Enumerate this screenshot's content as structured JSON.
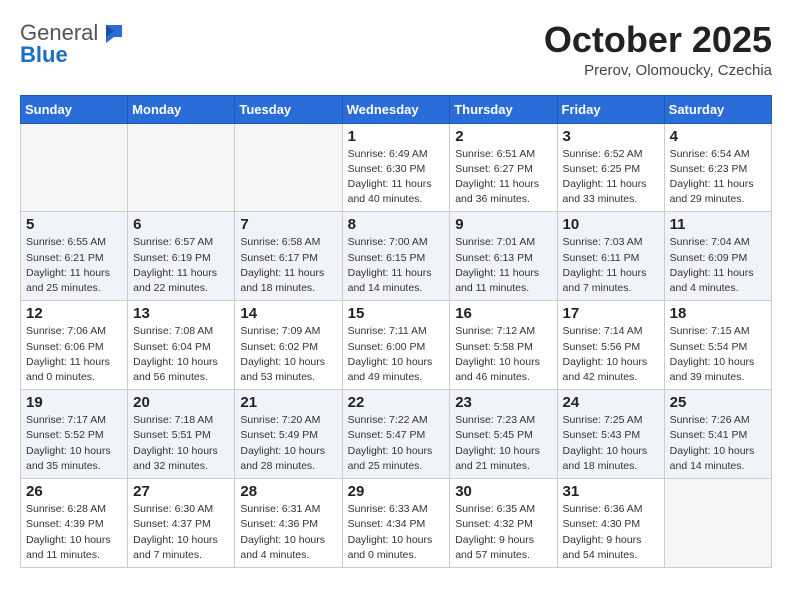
{
  "header": {
    "logo": {
      "general": "General",
      "blue": "Blue"
    },
    "title": "October 2025",
    "location": "Prerov, Olomoucky, Czechia"
  },
  "weekdays": [
    "Sunday",
    "Monday",
    "Tuesday",
    "Wednesday",
    "Thursday",
    "Friday",
    "Saturday"
  ],
  "weeks": [
    [
      {
        "day": "",
        "empty": true
      },
      {
        "day": "",
        "empty": true
      },
      {
        "day": "",
        "empty": true
      },
      {
        "day": "1",
        "sunrise": "6:49 AM",
        "sunset": "6:30 PM",
        "daylight": "11 hours and 40 minutes."
      },
      {
        "day": "2",
        "sunrise": "6:51 AM",
        "sunset": "6:27 PM",
        "daylight": "11 hours and 36 minutes."
      },
      {
        "day": "3",
        "sunrise": "6:52 AM",
        "sunset": "6:25 PM",
        "daylight": "11 hours and 33 minutes."
      },
      {
        "day": "4",
        "sunrise": "6:54 AM",
        "sunset": "6:23 PM",
        "daylight": "11 hours and 29 minutes."
      }
    ],
    [
      {
        "day": "5",
        "sunrise": "6:55 AM",
        "sunset": "6:21 PM",
        "daylight": "11 hours and 25 minutes."
      },
      {
        "day": "6",
        "sunrise": "6:57 AM",
        "sunset": "6:19 PM",
        "daylight": "11 hours and 22 minutes."
      },
      {
        "day": "7",
        "sunrise": "6:58 AM",
        "sunset": "6:17 PM",
        "daylight": "11 hours and 18 minutes."
      },
      {
        "day": "8",
        "sunrise": "7:00 AM",
        "sunset": "6:15 PM",
        "daylight": "11 hours and 14 minutes."
      },
      {
        "day": "9",
        "sunrise": "7:01 AM",
        "sunset": "6:13 PM",
        "daylight": "11 hours and 11 minutes."
      },
      {
        "day": "10",
        "sunrise": "7:03 AM",
        "sunset": "6:11 PM",
        "daylight": "11 hours and 7 minutes."
      },
      {
        "day": "11",
        "sunrise": "7:04 AM",
        "sunset": "6:09 PM",
        "daylight": "11 hours and 4 minutes."
      }
    ],
    [
      {
        "day": "12",
        "sunrise": "7:06 AM",
        "sunset": "6:06 PM",
        "daylight": "11 hours and 0 minutes."
      },
      {
        "day": "13",
        "sunrise": "7:08 AM",
        "sunset": "6:04 PM",
        "daylight": "10 hours and 56 minutes."
      },
      {
        "day": "14",
        "sunrise": "7:09 AM",
        "sunset": "6:02 PM",
        "daylight": "10 hours and 53 minutes."
      },
      {
        "day": "15",
        "sunrise": "7:11 AM",
        "sunset": "6:00 PM",
        "daylight": "10 hours and 49 minutes."
      },
      {
        "day": "16",
        "sunrise": "7:12 AM",
        "sunset": "5:58 PM",
        "daylight": "10 hours and 46 minutes."
      },
      {
        "day": "17",
        "sunrise": "7:14 AM",
        "sunset": "5:56 PM",
        "daylight": "10 hours and 42 minutes."
      },
      {
        "day": "18",
        "sunrise": "7:15 AM",
        "sunset": "5:54 PM",
        "daylight": "10 hours and 39 minutes."
      }
    ],
    [
      {
        "day": "19",
        "sunrise": "7:17 AM",
        "sunset": "5:52 PM",
        "daylight": "10 hours and 35 minutes."
      },
      {
        "day": "20",
        "sunrise": "7:18 AM",
        "sunset": "5:51 PM",
        "daylight": "10 hours and 32 minutes."
      },
      {
        "day": "21",
        "sunrise": "7:20 AM",
        "sunset": "5:49 PM",
        "daylight": "10 hours and 28 minutes."
      },
      {
        "day": "22",
        "sunrise": "7:22 AM",
        "sunset": "5:47 PM",
        "daylight": "10 hours and 25 minutes."
      },
      {
        "day": "23",
        "sunrise": "7:23 AM",
        "sunset": "5:45 PM",
        "daylight": "10 hours and 21 minutes."
      },
      {
        "day": "24",
        "sunrise": "7:25 AM",
        "sunset": "5:43 PM",
        "daylight": "10 hours and 18 minutes."
      },
      {
        "day": "25",
        "sunrise": "7:26 AM",
        "sunset": "5:41 PM",
        "daylight": "10 hours and 14 minutes."
      }
    ],
    [
      {
        "day": "26",
        "sunrise": "6:28 AM",
        "sunset": "4:39 PM",
        "daylight": "10 hours and 11 minutes."
      },
      {
        "day": "27",
        "sunrise": "6:30 AM",
        "sunset": "4:37 PM",
        "daylight": "10 hours and 7 minutes."
      },
      {
        "day": "28",
        "sunrise": "6:31 AM",
        "sunset": "4:36 PM",
        "daylight": "10 hours and 4 minutes."
      },
      {
        "day": "29",
        "sunrise": "6:33 AM",
        "sunset": "4:34 PM",
        "daylight": "10 hours and 0 minutes."
      },
      {
        "day": "30",
        "sunrise": "6:35 AM",
        "sunset": "4:32 PM",
        "daylight": "9 hours and 57 minutes."
      },
      {
        "day": "31",
        "sunrise": "6:36 AM",
        "sunset": "4:30 PM",
        "daylight": "9 hours and 54 minutes."
      },
      {
        "day": "",
        "empty": true
      }
    ]
  ]
}
